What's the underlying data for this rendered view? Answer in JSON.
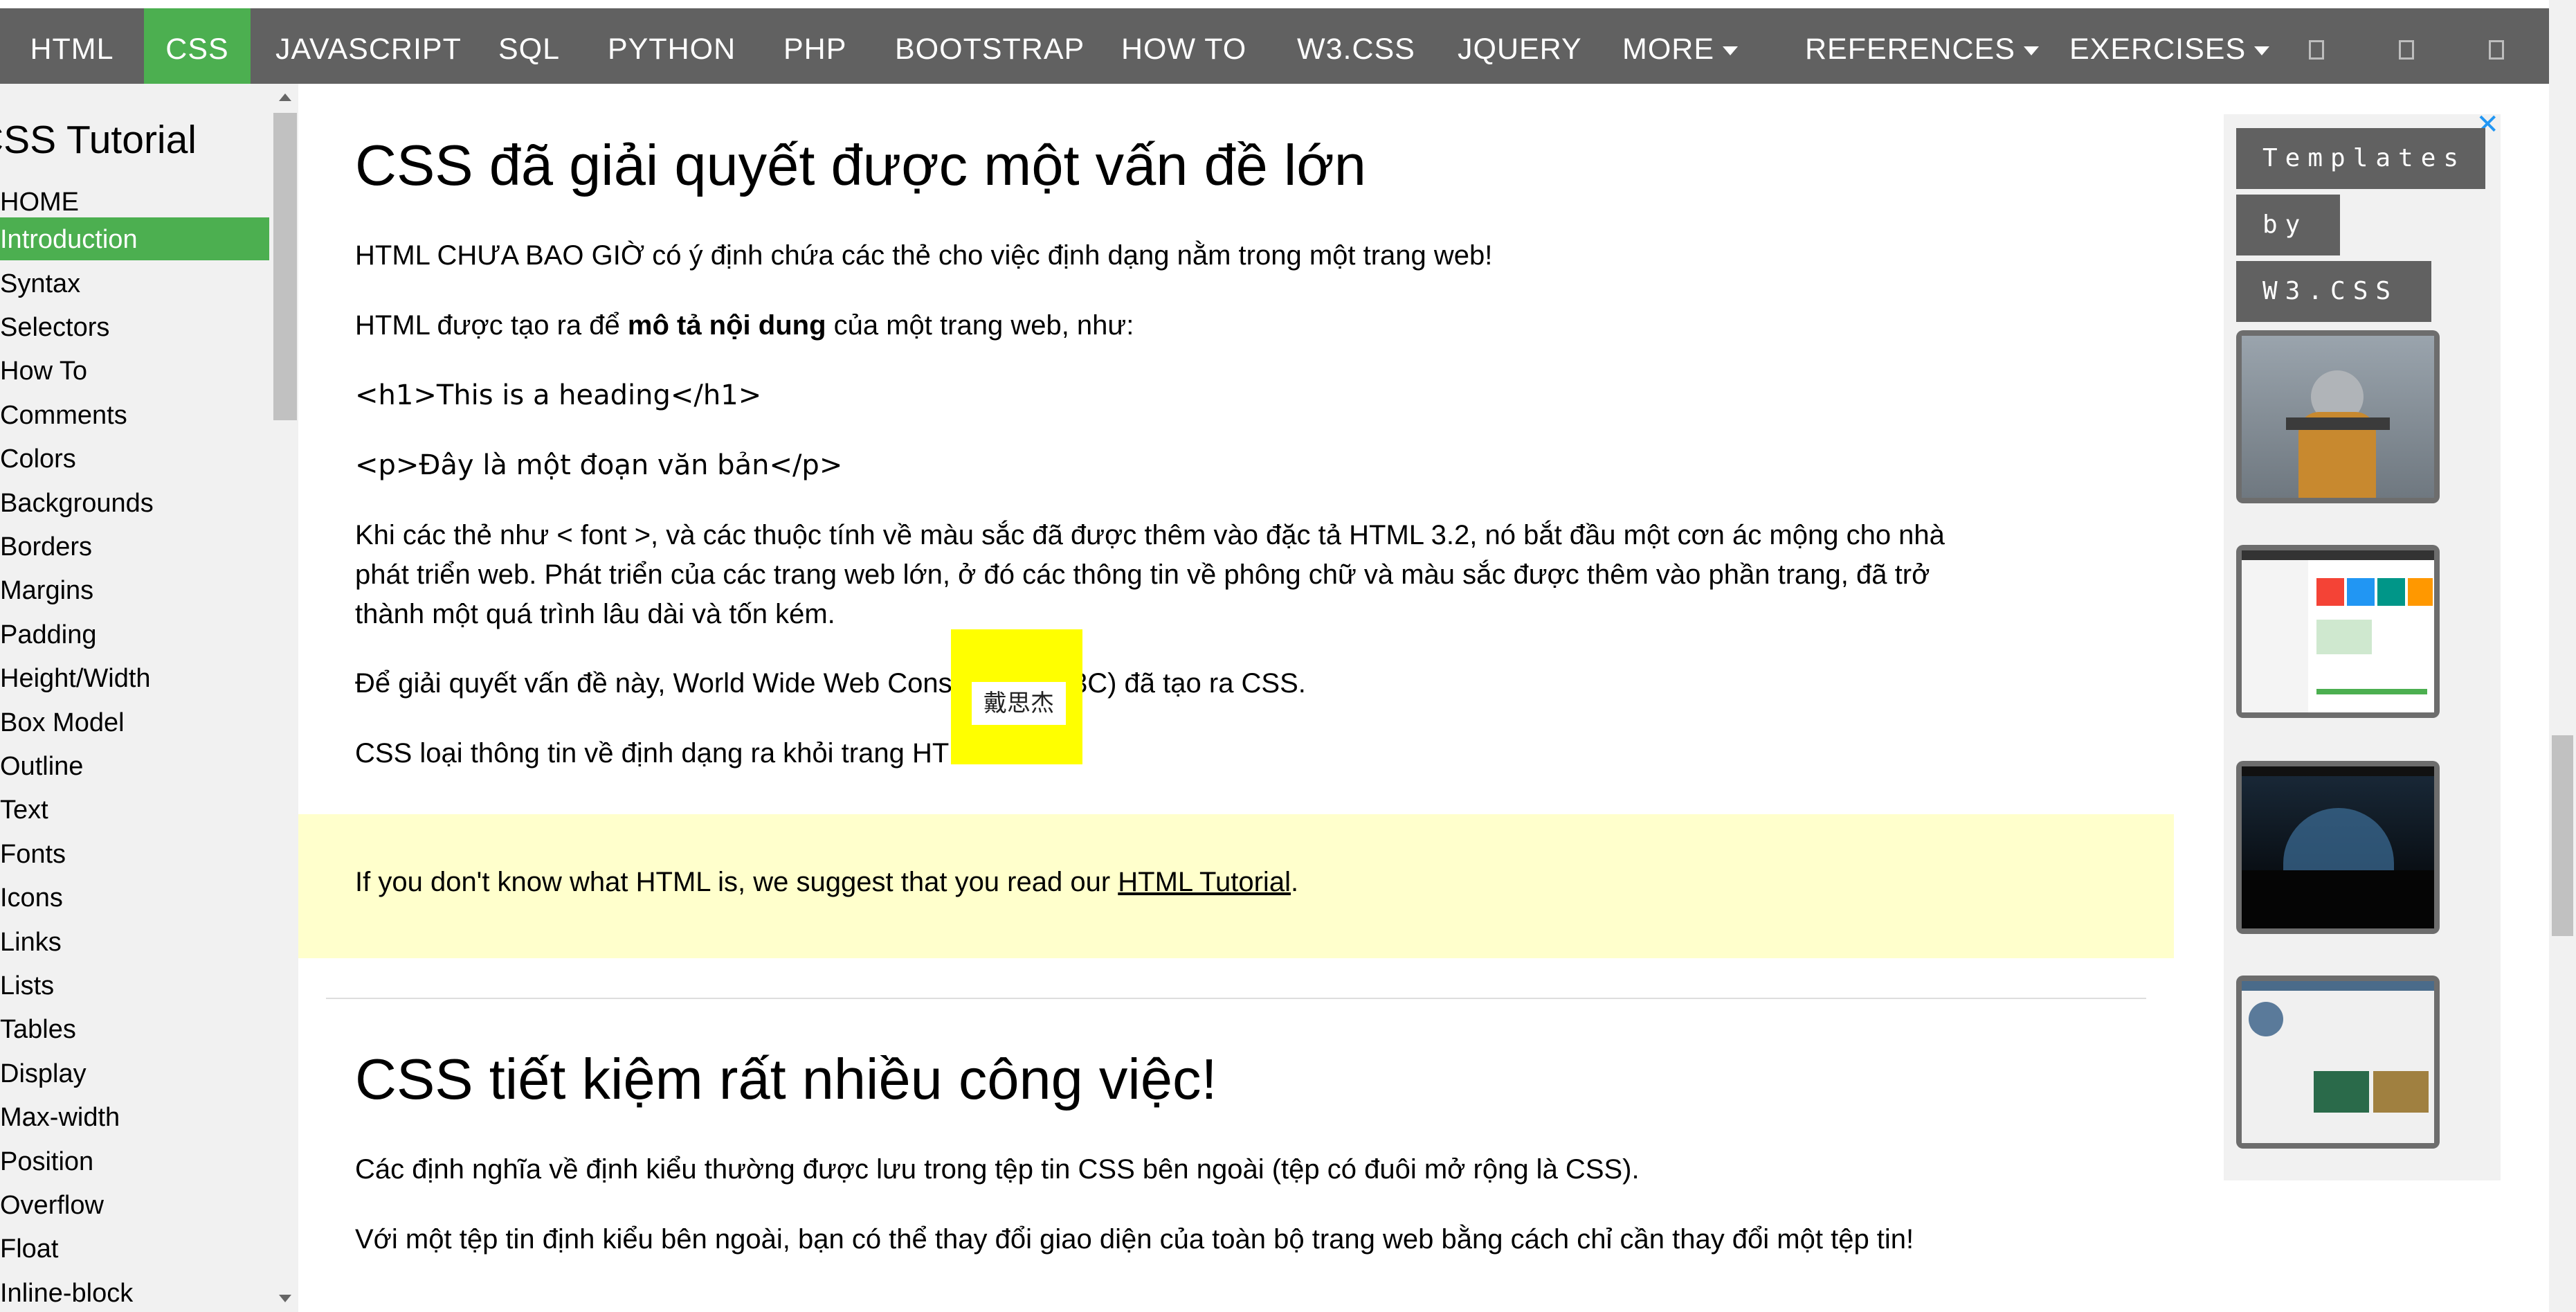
{
  "nav": {
    "items": [
      {
        "label": "HTML",
        "active": false,
        "dropdown": false
      },
      {
        "label": "CSS",
        "active": true,
        "dropdown": false
      },
      {
        "label": "JAVASCRIPT",
        "active": false,
        "dropdown": false
      },
      {
        "label": "SQL",
        "active": false,
        "dropdown": false
      },
      {
        "label": "PYTHON",
        "active": false,
        "dropdown": false
      },
      {
        "label": "PHP",
        "active": false,
        "dropdown": false
      },
      {
        "label": "BOOTSTRAP",
        "active": false,
        "dropdown": false
      },
      {
        "label": "HOW TO",
        "active": false,
        "dropdown": false
      },
      {
        "label": "W3.CSS",
        "active": false,
        "dropdown": false
      },
      {
        "label": "JQUERY",
        "active": false,
        "dropdown": false
      },
      {
        "label": "MORE",
        "active": false,
        "dropdown": true
      },
      {
        "label": "REFERENCES",
        "active": false,
        "dropdown": true
      },
      {
        "label": "EXERCISES",
        "active": false,
        "dropdown": true
      }
    ],
    "icons": [
      "icon-1",
      "icon-2",
      "icon-3"
    ],
    "accent_color": "#4CAF50",
    "bar_color": "#616161"
  },
  "sidebar": {
    "title": "CSS Tutorial",
    "items": [
      {
        "label": "HOME",
        "active": false
      },
      {
        "label": "Introduction",
        "active": true
      },
      {
        "label": "Syntax",
        "active": false
      },
      {
        "label": "Selectors",
        "active": false
      },
      {
        "label": "How To",
        "active": false
      },
      {
        "label": "Comments",
        "active": false
      },
      {
        "label": "Colors",
        "active": false
      },
      {
        "label": "Backgrounds",
        "active": false
      },
      {
        "label": "Borders",
        "active": false
      },
      {
        "label": "Margins",
        "active": false
      },
      {
        "label": "Padding",
        "active": false
      },
      {
        "label": "Height/Width",
        "active": false
      },
      {
        "label": "Box Model",
        "active": false
      },
      {
        "label": "Outline",
        "active": false
      },
      {
        "label": "Text",
        "active": false
      },
      {
        "label": "Fonts",
        "active": false
      },
      {
        "label": "Icons",
        "active": false
      },
      {
        "label": "Links",
        "active": false
      },
      {
        "label": "Lists",
        "active": false
      },
      {
        "label": "Tables",
        "active": false
      },
      {
        "label": "Display",
        "active": false
      },
      {
        "label": "Max-width",
        "active": false
      },
      {
        "label": "Position",
        "active": false
      },
      {
        "label": "Overflow",
        "active": false
      },
      {
        "label": "Float",
        "active": false
      },
      {
        "label": "Inline-block",
        "active": false
      }
    ]
  },
  "main": {
    "section1": {
      "heading": "CSS đã giải quyết được một vấn đề lớn",
      "p1": "HTML CHƯA BAO GIỜ có ý định chứa các thẻ cho việc định dạng nằm trong một trang web!",
      "p2_before": "HTML được tạo ra để ",
      "p2_bold": "mô tả nội dung",
      "p2_after": " của một trang web, như:",
      "code1": "<h1>This is a heading</h1>",
      "code2": "<p>Đây là một đoạn văn bản</p>",
      "p3_line1": "Khi các thẻ như < font >, và các thuộc tính về màu sắc đã được thêm vào đặc tả HTML 3.2, nó bắt đầu một cơn ác mộng cho nhà",
      "p3_line2": "phát triển web. Phát triển của các trang web lớn, ở đó các thông tin về phông chữ và màu sắc được thêm vào phần trang, đã trở",
      "p3_line3": "thành một quá trình lâu dài và tốn kém.",
      "p4": "Để giải quyết vấn đề này, World Wide Web Consortium (W3C) đã tạo ra CSS.",
      "p5": "CSS loại thông tin về định dạng ra khỏi trang HTML!"
    },
    "note": {
      "text_before": "If you don't know what HTML is, we suggest that you read our ",
      "link": "HTML Tutorial",
      "text_after": ".",
      "bg_color": "#ffffcc"
    },
    "section2": {
      "heading": "CSS tiết kiệm rất nhiều công việc!",
      "p1": "Các định nghĩa về định kiểu thường được lưu trong tệp tin CSS bên ngoài (tệp có đuôi mở rộng là CSS).",
      "p2": "Với một tệp tin định kiểu bên ngoài, bạn có thể thay đổi giao diện của toàn bộ trang web bằng cách chỉ cần thay đổi một tệp tin!"
    },
    "overlay_label": "戴思杰"
  },
  "ad": {
    "close": "✕",
    "tags": [
      "Templates",
      "by",
      "W3.CSS"
    ],
    "thumbnails": [
      "template-thumbnail-1",
      "template-thumbnail-2",
      "template-thumbnail-3",
      "template-thumbnail-4"
    ]
  }
}
